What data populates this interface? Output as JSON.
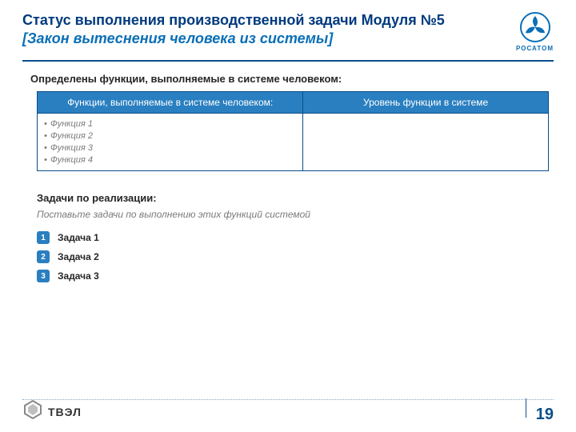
{
  "header": {
    "title_line1": "Статус выполнения производственной задачи Модуля №5",
    "title_line2": "[Закон вытеснения человека из системы]",
    "rosatom_label": "РОСАТОМ"
  },
  "sections": {
    "functions_heading": "Определены функции, выполняемые в системе человеком:",
    "tasks_heading": "Задачи по реализации:",
    "tasks_note": "Поставьте задачи по выполнению этих функций системой"
  },
  "table": {
    "col1": "Функции, выполняемые в системе человеком:",
    "col2": "Уровень функции в системе",
    "rows": [
      {
        "f": "Функция 1"
      },
      {
        "f": "Функция 2"
      },
      {
        "f": "Функция 3"
      },
      {
        "f": "Функция 4"
      }
    ],
    "level_value": ""
  },
  "tasks": [
    {
      "n": "1",
      "label": "Задача 1"
    },
    {
      "n": "2",
      "label": "Задача 2"
    },
    {
      "n": "3",
      "label": "Задача 3"
    }
  ],
  "footer": {
    "tvel": "ТВЭЛ",
    "page": "19"
  }
}
